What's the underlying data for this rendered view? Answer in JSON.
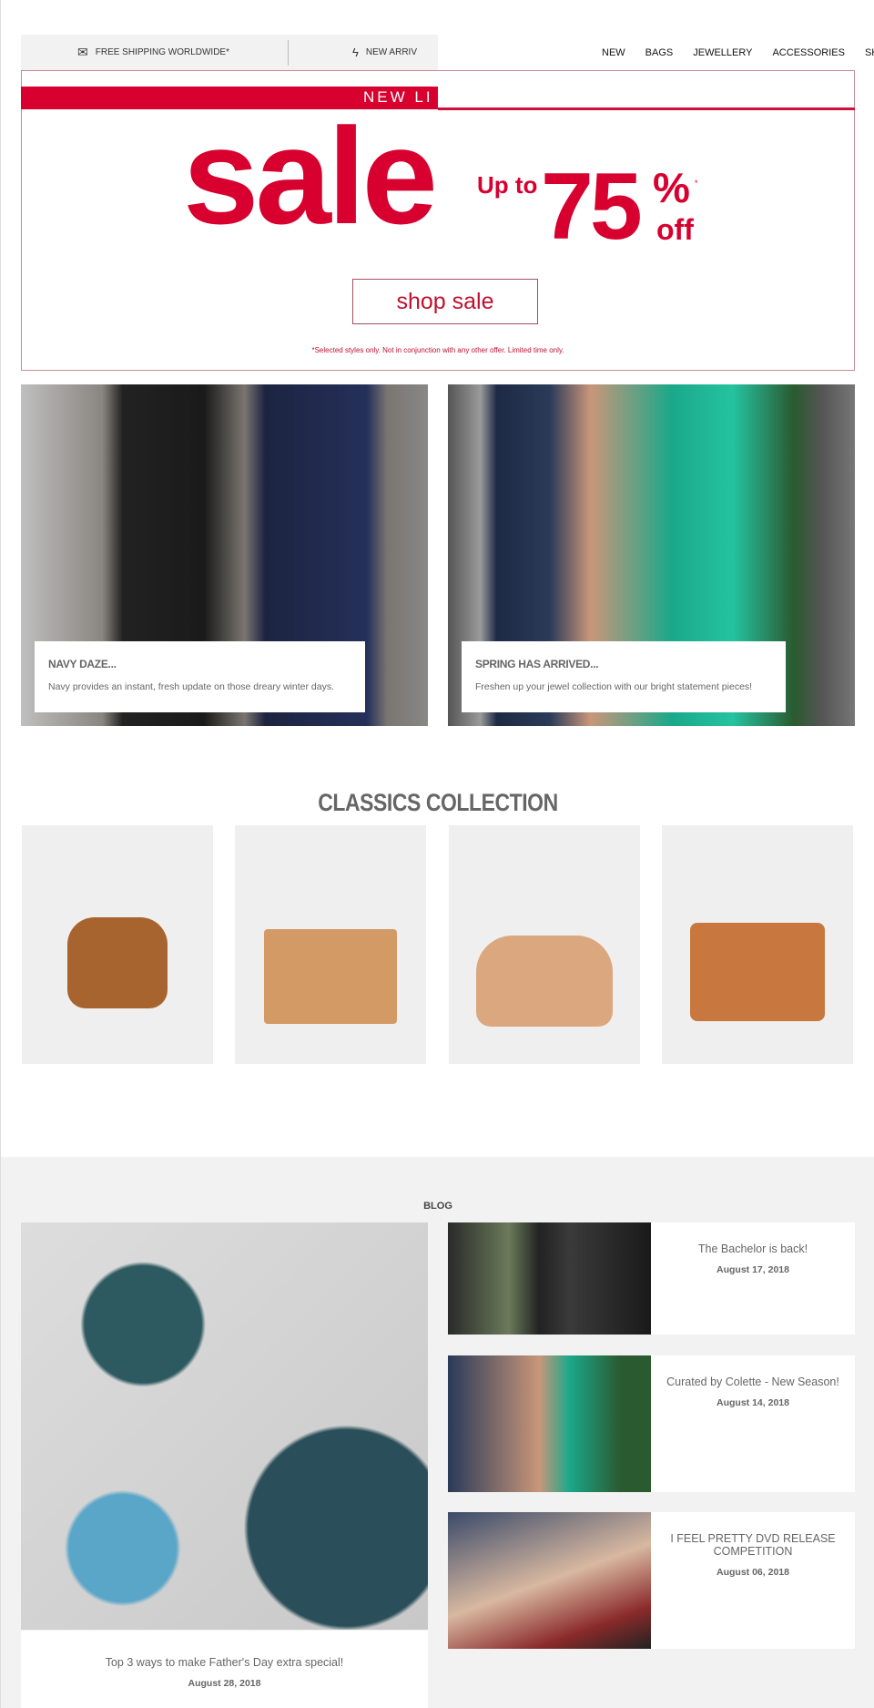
{
  "topbar": {
    "items": [
      {
        "icon": "shipping-tag-icon",
        "label": "FREE SHIPPING WORLDWIDE*"
      },
      {
        "icon": "lightning-icon",
        "label": "NEW ARRIV"
      }
    ]
  },
  "nav": {
    "items": [
      "NEW",
      "BAGS",
      "JEWELLERY",
      "ACCESSORIES",
      "SHO"
    ]
  },
  "banner": {
    "strip": "NEW LI",
    "sale": "sale",
    "upto": "Up to",
    "number": "75",
    "percent": "%",
    "asterisk": "*",
    "off": "off",
    "button": "shop sale",
    "disclaimer": "*Selected styles only. Not in conjunction with any other offer. Limited time only.",
    "accent": "#d7002f"
  },
  "features": [
    {
      "title": "NAVY DAZE...",
      "text": "Navy provides an instant, fresh update on those dreary winter days."
    },
    {
      "title": "SPRING HAS ARRIVED...",
      "text": "Freshen up your jewel collection with our bright statement pieces!"
    }
  ],
  "classics": {
    "title": "CLASSICS COLLECTION",
    "products": [
      "bucket-bag",
      "tote-bag",
      "hobo-bag",
      "satchel-bag"
    ]
  },
  "blog": {
    "label": "BLOG",
    "featured": {
      "title": "Top 3 ways to make Father's Day extra special!",
      "date": "August 28, 2018"
    },
    "posts": [
      {
        "title": "The Bachelor is back!",
        "date": "August 17, 2018"
      },
      {
        "title": "Curated by Colette - New Season!",
        "date": "August 14, 2018"
      },
      {
        "title": "I FEEL PRETTY DVD RELEASE COMPETITION",
        "date": "August 06, 2018"
      }
    ]
  }
}
